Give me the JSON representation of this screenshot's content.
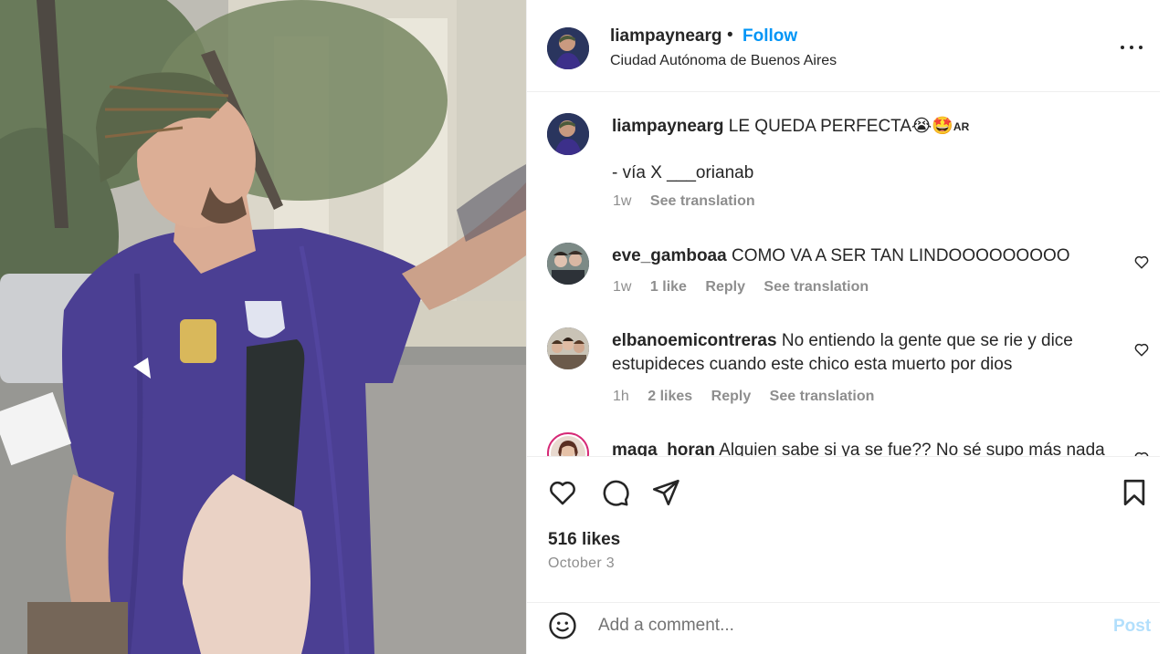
{
  "post": {
    "username": "liampaynearg",
    "dot": "•",
    "follow_label": "Follow",
    "location": "Ciudad Autónoma de Buenos Aires",
    "caption": {
      "username": "liampaynearg",
      "text": "LE QUEDA PERFECTA",
      "emojis": "😭🤩",
      "flag_text": "AR",
      "source": "- vía X ___orianab",
      "time": "1w",
      "see_translation": "See translation"
    },
    "likes_text": "516 likes",
    "date": "October 3"
  },
  "comments": [
    {
      "username": "eve_gamboaa",
      "text": "COMO VA A SER TAN LINDOOOOOOOOO",
      "time": "1w",
      "likes": "1 like",
      "reply": "Reply",
      "see_translation": "See translation"
    },
    {
      "username": "elbanoemicontreras",
      "text": "No entiendo la gente que se rie y dice estupideces cuando este chico esta muerto por dios",
      "time": "1h",
      "likes": "2 likes",
      "reply": "Reply",
      "see_translation": "See translation"
    },
    {
      "username": "maga_horan",
      "text": "Alquien sabe si ya se fue?? No sé supo más nada"
    }
  ],
  "comment_box": {
    "placeholder": "Add a comment...",
    "post_label": "Post"
  },
  "icons": {
    "more": "more-options-icon",
    "like": "heart-icon",
    "comment": "comment-icon",
    "share": "share-icon",
    "save": "bookmark-icon",
    "emoji": "emoji-icon"
  },
  "colors": {
    "accent": "#0095f6",
    "post_disabled": "#b2dffc",
    "muted": "#8e8e8e",
    "jersey": "#3c2f8a"
  }
}
